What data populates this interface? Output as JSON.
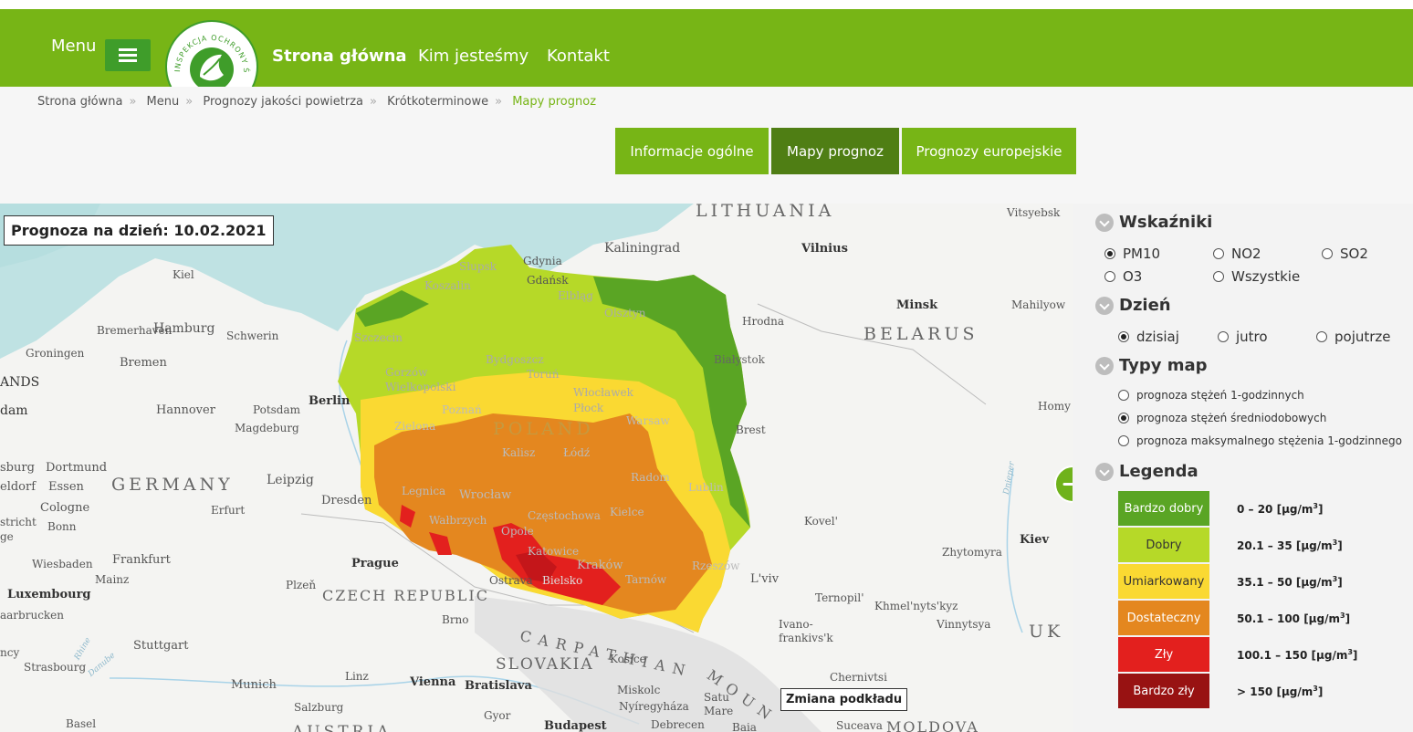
{
  "header": {
    "menu_label": "Menu",
    "logo_text": "INSPEKCJA OCHRONY ŚRODOWISKA",
    "nav": [
      "Strona główna",
      "Kim jesteśmy",
      "Kontakt"
    ]
  },
  "breadcrumb": [
    "Strona główna",
    "Menu",
    "Prognozy jakości powietrza",
    "Krótkoterminowe",
    "Mapy prognoz"
  ],
  "tabs": [
    "Informacje ogólne",
    "Mapy prognoz",
    "Prognozy europejskie"
  ],
  "map": {
    "forecast_label": "Prognoza na dzień: 10.02.2021",
    "basemap_button": "Zmiana podkładu",
    "labels": {
      "lithuania": "LITHUANIA",
      "vitsyebsk": "Vitsyebsk",
      "kaliningrad": "Kaliningrad",
      "gdynia": "Gdynia",
      "gdansk": "Gdańsk",
      "slupsk": "Słupsk",
      "elblag": "Elbląg",
      "koszalin": "Koszalin",
      "olsztyn": "Olsztyn",
      "vilnius": "Vilnius",
      "minsk": "Minsk",
      "mahilyow": "Mahilyow",
      "hrodna": "Hrodna",
      "belarus": "BELARUS",
      "kiel": "Kiel",
      "bremerhaven": "Bremerhaven",
      "hamburg": "Hamburg",
      "schwerin": "Schwerin",
      "groningen": "Groningen",
      "bremen": "Bremen",
      "szczecin": "Szczecin",
      "bydgoszcz": "Bydgoszcz",
      "torun": "Toruń",
      "bialystok": "Białystok",
      "ands": "ANDS",
      "dam": "dam",
      "hannover": "Hannover",
      "potsdam": "Potsdam",
      "berlin": "Berlin",
      "gorzow": "Gorzów",
      "wielkopolski": "Wielkopolski",
      "wloclawek": "Włocławek",
      "plock": "Płock",
      "magdeburg": "Magdeburg",
      "poznan": "Poznań",
      "poland": "POLAND",
      "warsaw": "Warsaw",
      "brest": "Brest",
      "homy": "Homy",
      "zielona": "Zielona",
      "kalisz": "Kalisz",
      "lodz": "Łódź",
      "sburg": "sburg",
      "dortmund": "Dortmund",
      "germany": "GERMANY",
      "leipzig": "Leipzig",
      "radom": "Radom",
      "eldorf": "eldorf",
      "essen": "Essen",
      "erfurt": "Erfurt",
      "legnica": "Legnica",
      "wroclaw": "Wrocław",
      "lublin": "Lublin",
      "cologne": "Cologne",
      "dresden": "Dresden",
      "czestochowa": "Częstochowa",
      "kielce": "Kielce",
      "kovel": "Kovel'",
      "stricht": "stricht",
      "bonn": "Bonn",
      "walbrzych": "Wałbrzych",
      "opole": "Opole",
      "kiev": "Kiev",
      "ge": "ge",
      "katowice": "Katowice",
      "zhytomyra": "Zhytomyra",
      "wiesbaden": "Wiesbaden",
      "frankfurt": "Frankfurt",
      "prague": "Prague",
      "krakow": "Kraków",
      "rzeszow": "Rzeszów",
      "mainz": "Mainz",
      "plzen": "Plzeň",
      "ostrava": "Ostrava",
      "bielsko": "Bielsko",
      "tarnow": "Tarnów",
      "lviv": "L'viv",
      "luxembourg": "Luxembourg",
      "czech": "CZECH REPUBLIC",
      "ternopil": "Ternopil'",
      "khmelnytskyz": "Khmel'nyts'kyz",
      "aarbrucken": "aarbrucken",
      "brno": "Brno",
      "ivano": "Ivano-",
      "frankivsk": "frankivs'k",
      "vinnytsya": "Vinnytsya",
      "uk": "UK",
      "carpathian": "CARPATHIAN",
      "mount": "MOUN",
      "stuttgart": "Stuttgart",
      "slovakia": "SLOVAKIA",
      "kosice": "Kosice",
      "ncy": "ncy",
      "strasbourg": "Strasbourg",
      "linz": "Linz",
      "chernivtsi": "Chernivtsi",
      "munich": "Munich",
      "vienna": "Vienna",
      "bratislava": "Bratislava",
      "miskolc": "Miskolc",
      "nyiregyhaza": "Nyíregyháza",
      "satu": "Satu",
      "mare": "Mare",
      "salzburg": "Salzburg",
      "gyor": "Gyor",
      "basel": "Basel",
      "austria": "AUSTRIA",
      "budapest": "Budapest",
      "debrecen": "Debrecen",
      "baia": "Baia",
      "suceava": "Suceava",
      "moldova": "MOLDOVA",
      "dnieper": "Dnieper",
      "rhine": "Rhine",
      "danube": "Danube"
    }
  },
  "panel": {
    "indicators_title": "Wskaźniki",
    "indicators": [
      {
        "label": "PM10",
        "selected": true
      },
      {
        "label": "NO2",
        "selected": false
      },
      {
        "label": "SO2",
        "selected": false
      },
      {
        "label": "O3",
        "selected": false
      },
      {
        "label": "Wszystkie",
        "selected": false
      }
    ],
    "day_title": "Dzień",
    "days": [
      {
        "label": "dzisiaj",
        "selected": true
      },
      {
        "label": "jutro",
        "selected": false
      },
      {
        "label": "pojutrze",
        "selected": false
      }
    ],
    "map_types_title": "Typy map",
    "map_types": [
      {
        "label": "prognoza stężeń 1-godzinnych",
        "selected": false
      },
      {
        "label": "prognoza stężeń średniodobowych",
        "selected": true
      },
      {
        "label": "prognoza maksymalnego stężenia 1-godzinnego",
        "selected": false
      }
    ],
    "legend_title": "Legenda",
    "legend": [
      {
        "label": "Bardzo dobry",
        "range": "0 – 20 [μg/m",
        "color": "#5aa524",
        "text_color": "#ffffff"
      },
      {
        "label": "Dobry",
        "range": "20.1 – 35 [μg/m",
        "color": "#b6d928",
        "text_color": "#333333"
      },
      {
        "label": "Umiarkowany",
        "range": "35.1 – 50 [μg/m",
        "color": "#fad932",
        "text_color": "#333333"
      },
      {
        "label": "Dostateczny",
        "range": "50.1 – 100 [μg/m",
        "color": "#e4871f",
        "text_color": "#ffffff"
      },
      {
        "label": "Zły",
        "range": "100.1 – 150 [μg/m",
        "color": "#e3201e",
        "text_color": "#ffffff"
      },
      {
        "label": "Bardzo zły",
        "range": "> 150 [μg/m",
        "color": "#981212",
        "text_color": "#ffffff"
      }
    ],
    "unit_sup": "3",
    "unit_close": "]"
  }
}
